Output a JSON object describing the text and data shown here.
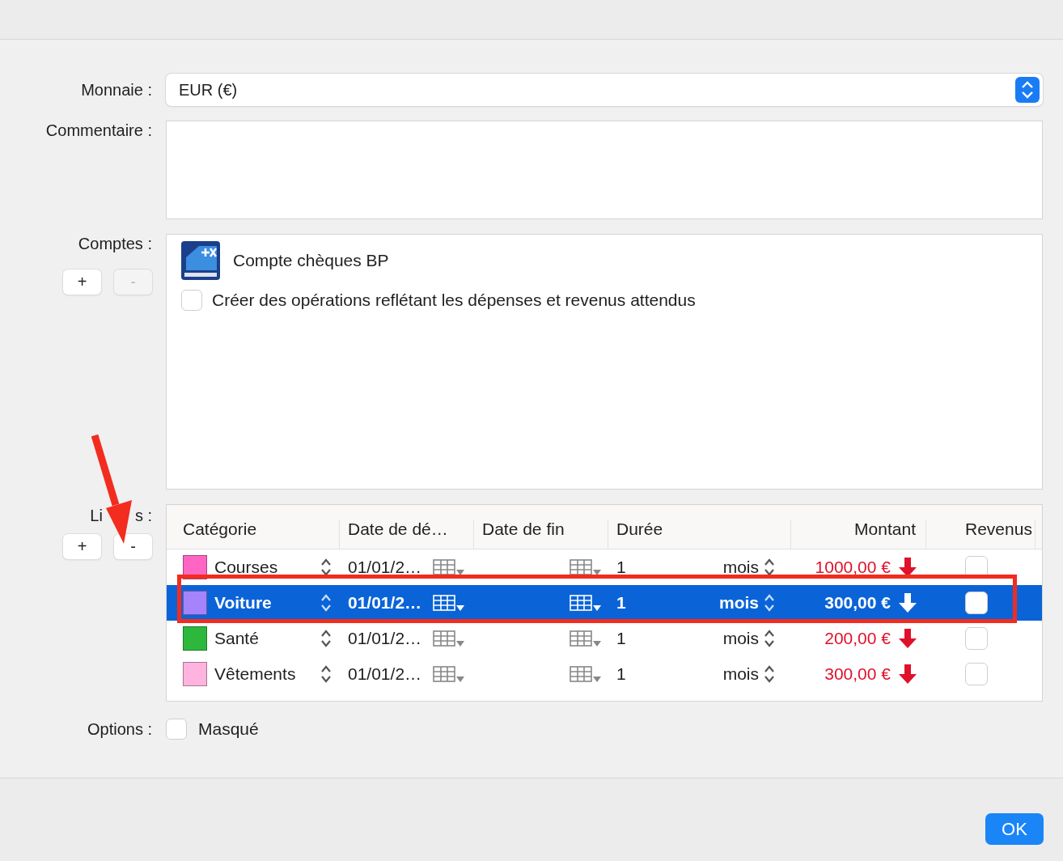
{
  "form": {
    "currency": {
      "label": "Monnaie :",
      "value": "EUR (€)"
    },
    "comment": {
      "label": "Commentaire :"
    },
    "accounts": {
      "label": "Comptes :",
      "add": "+",
      "remove": "-",
      "remove_disabled": true,
      "items": [
        {
          "name": "Compte chèques BP"
        }
      ],
      "create_ops": {
        "label": "Créer des opérations reflétant les dépenses et revenus attendus",
        "checked": false
      }
    },
    "lines": {
      "label_parts": [
        "Li",
        "s :"
      ],
      "add": "+",
      "remove": "-",
      "remove_disabled": false,
      "columns": [
        "Catégorie",
        "Date de dé…",
        "Date de fin",
        "Durée",
        "Montant",
        "Revenus"
      ],
      "rows": [
        {
          "category": "Courses",
          "color": "#ff66c4",
          "start": "01/01/2…",
          "duration": "1",
          "unit": "mois",
          "amount": "1000,00 €",
          "income": false,
          "selected": false
        },
        {
          "category": "Voiture",
          "color": "#a583fa",
          "start": "01/01/2…",
          "duration": "1",
          "unit": "mois",
          "amount": "300,00 €",
          "income": false,
          "selected": true
        },
        {
          "category": "Santé",
          "color": "#2db83d",
          "start": "01/01/2…",
          "duration": "1",
          "unit": "mois",
          "amount": "200,00 €",
          "income": false,
          "selected": false
        },
        {
          "category": "Vêtements",
          "color": "#ffb3df",
          "start": "01/01/2…",
          "duration": "1",
          "unit": "mois",
          "amount": "300,00 €",
          "income": false,
          "selected": false
        }
      ]
    },
    "options": {
      "label": "Options :",
      "items": [
        {
          "label": "Masqué",
          "checked": false
        }
      ]
    }
  },
  "ok": "OK"
}
